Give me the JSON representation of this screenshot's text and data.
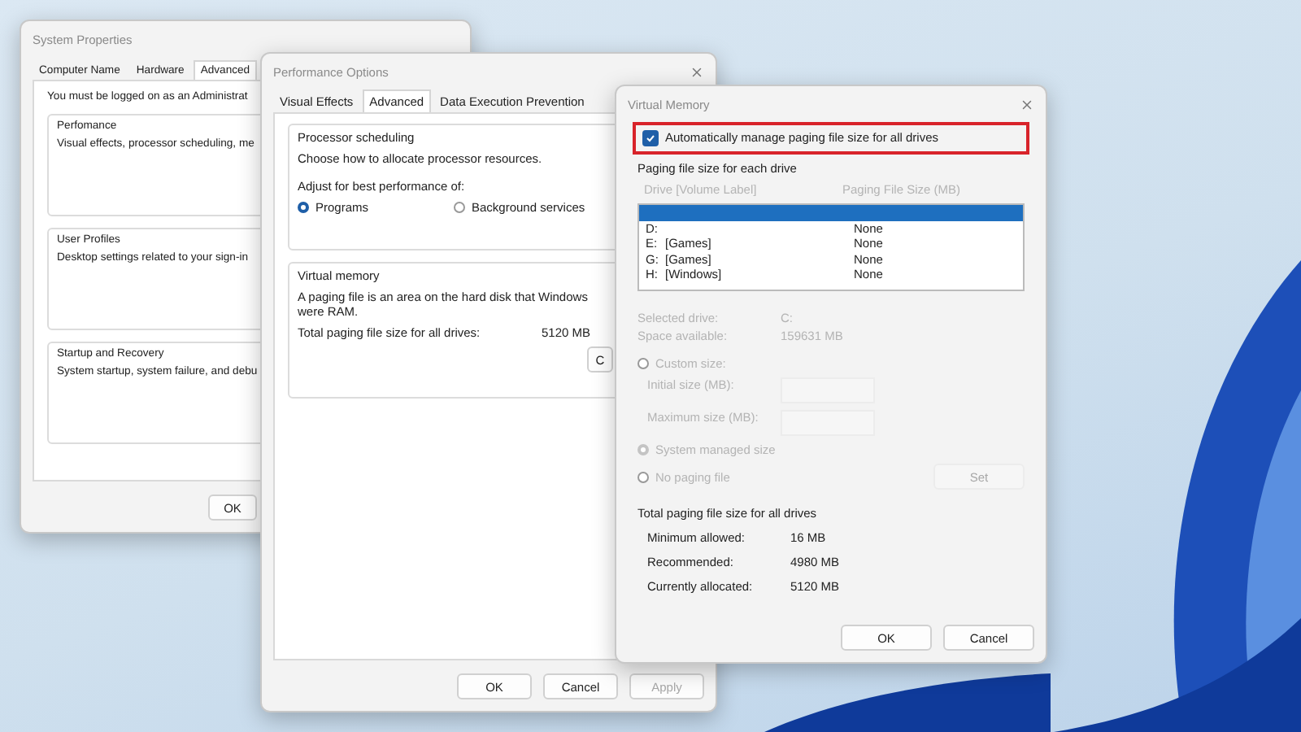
{
  "system_properties": {
    "title": "System Properties",
    "tabs": [
      {
        "label": "Computer Name",
        "selected": false
      },
      {
        "label": "Hardware",
        "selected": false
      },
      {
        "label": "Advanced",
        "selected": true
      }
    ],
    "notice": "You must be logged on as an Administrat",
    "groups": [
      {
        "title": "Perfomance",
        "text": "Visual effects, processor scheduling, me"
      },
      {
        "title": "User Profiles",
        "text": "Desktop settings related to your sign-in"
      },
      {
        "title": "Startup and Recovery",
        "text": "System startup, system failure, and debu"
      }
    ],
    "buttons": [
      {
        "label": "OK",
        "disabled": false
      }
    ]
  },
  "performance_options": {
    "title": "Performance Options",
    "tabs": [
      {
        "label": "Visual Effects",
        "selected": false
      },
      {
        "label": "Advanced",
        "selected": true
      },
      {
        "label": "Data Execution Prevention",
        "selected": false
      }
    ],
    "processor_scheduling": {
      "title": "Processor scheduling",
      "text": "Choose how to allocate processor resources.",
      "prompt": "Adjust for best performance of:",
      "options": [
        {
          "label": "Programs",
          "selected": true
        },
        {
          "label": "Background services",
          "selected": false
        }
      ]
    },
    "virtual_memory": {
      "title": "Virtual memory",
      "text_line_1": "A paging file is an area on the hard disk that Windows",
      "text_line_2": "were RAM.",
      "total_label": "Total paging file size for all drives:",
      "total_value": "5120 MB",
      "change_button": "C"
    },
    "buttons": [
      {
        "label": "OK",
        "disabled": false
      },
      {
        "label": "Cancel",
        "disabled": false
      },
      {
        "label": "Apply",
        "disabled": true
      }
    ]
  },
  "virtual_memory": {
    "title": "Virtual Memory",
    "auto_manage": {
      "label": "Automatically manage paging file size for all drives",
      "checked": true
    },
    "drives_title": "Paging file size for each drive",
    "columns": [
      "Drive  [Volume Label]",
      "Paging File Size (MB)"
    ],
    "drives": [
      {
        "selected": true
      },
      {
        "drive": "D:",
        "size": "None",
        "selected": false
      },
      {
        "drive": "E:",
        "label": "[Games]",
        "size": "None",
        "selected": false
      },
      {
        "drive": "G:",
        "label": "[Games]",
        "size": "None",
        "selected": false
      },
      {
        "drive": "H:",
        "label": "[Windows]",
        "size": "None",
        "selected": false
      }
    ],
    "disabled": true,
    "selected_drive_label": "Selected drive:",
    "selected_drive": "C:",
    "space_label": "Space available:",
    "space": "159631 MB",
    "size_options": [
      {
        "label": "Custom size:",
        "selected": false
      },
      {
        "label": "System managed size",
        "selected": true
      },
      {
        "label": "No paging file",
        "selected": false
      }
    ],
    "initial_label": "Initial size (MB):",
    "maximum_label": "Maximum size (MB):",
    "set_button": "Set",
    "totals_title": "Total paging file size for all drives",
    "totals": [
      {
        "label": "Minimum allowed:",
        "value": "16 MB"
      },
      {
        "label": "Recommended:",
        "value": "4980 MB"
      },
      {
        "label": "Currently allocated:",
        "value": "5120 MB"
      }
    ],
    "buttons": [
      {
        "label": "OK",
        "disabled": false
      },
      {
        "label": "Cancel",
        "disabled": false
      }
    ]
  }
}
